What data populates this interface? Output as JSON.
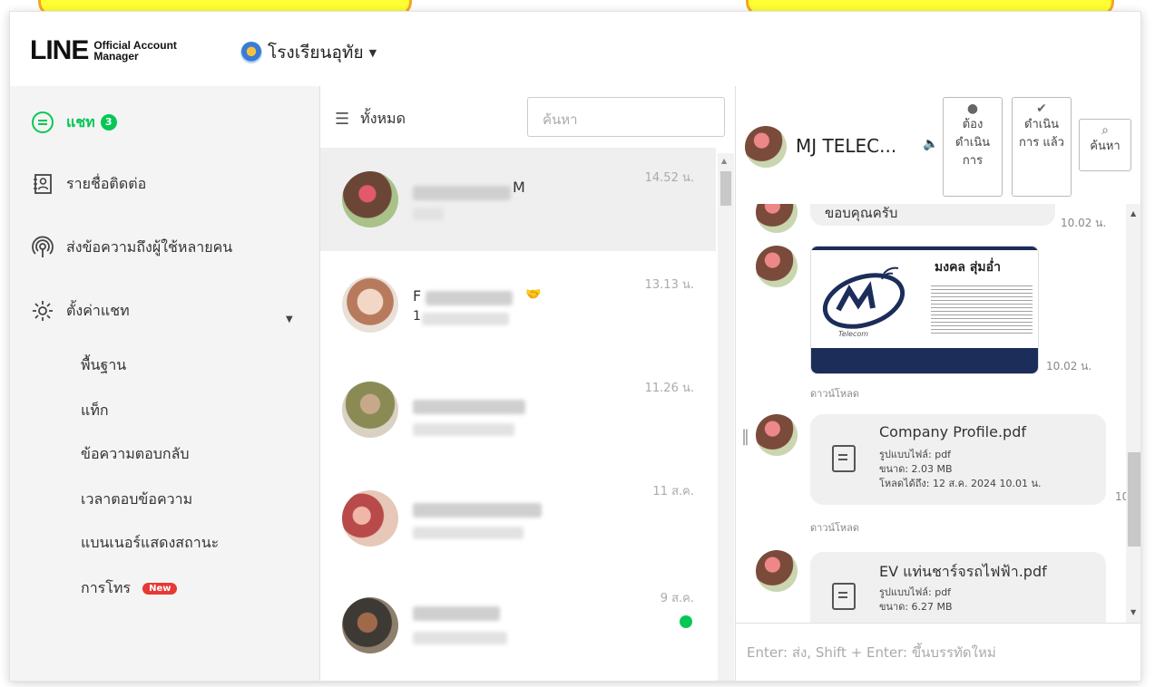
{
  "app": {
    "logo_main": "LINE",
    "logo_sub_1": "Official Account",
    "logo_sub_2": "Manager",
    "account_name": "โรงเรียนอุทัย"
  },
  "sidebar": {
    "items": [
      {
        "label": "แชท",
        "badge": "3",
        "icon": "chat-bubble-icon",
        "active": true
      },
      {
        "label": "รายชื่อติดต่อ",
        "icon": "contact-card-icon"
      },
      {
        "label": "ส่งข้อความถึงผู้ใช้หลายคน",
        "icon": "broadcast-icon"
      },
      {
        "label": "ตั้งค่าแชท",
        "icon": "gear-icon",
        "expanded": true
      }
    ],
    "sub_items": [
      {
        "label": "พื้นฐาน"
      },
      {
        "label": "แท็ก"
      },
      {
        "label": "ข้อความตอบกลับ"
      },
      {
        "label": "เวลาตอบข้อความ"
      },
      {
        "label": "แบนเนอร์แสดงสถานะ"
      },
      {
        "label": "การโทร",
        "badge": "New"
      }
    ]
  },
  "chat_list": {
    "filter_label": "ทั้งหมด",
    "search_placeholder": "ค้นหา",
    "rows": [
      {
        "name_visible": "M",
        "time": "14.52 น.",
        "selected": true
      },
      {
        "name_visible": "F",
        "time": "13.13 น.",
        "sub_visible": "1"
      },
      {
        "time": "11.26 น."
      },
      {
        "time": "11 ส.ค."
      },
      {
        "time": "9 ส.ค.",
        "unread": true
      }
    ]
  },
  "chat": {
    "contact_name": "MJ TELEC...",
    "buttons": {
      "todo_label": "ต้อง ดำเนิน การ",
      "done_label": "ดำเนิน การ แล้ว",
      "search_label": "ค้นหา"
    },
    "messages": [
      {
        "text": "ขอบคุณครับ",
        "time": "10.02 น."
      },
      {
        "type": "image",
        "time": "10.02 น.",
        "card_name": "มงคล สุ่มอ่ำ",
        "card_brand": "Telecom"
      },
      {
        "type": "file",
        "download_label": "ดาวน์โหลด",
        "file_name": "Company Profile.pdf",
        "meta_type": "รูปแบบไฟล์: pdf",
        "meta_size": "ขนาด: 2.03 MB",
        "meta_until": "โหลดได้ถึง: 12 ส.ค. 2024 10.01 น.",
        "time_partial": "10"
      },
      {
        "type": "file",
        "download_label": "ดาวน์โหลด",
        "file_name": "EV แท่นชาร์จรถไฟฟ้า.pdf",
        "meta_type": "รูปแบบไฟล์: pdf",
        "meta_size": "ขนาด: 6.27 MB"
      }
    ],
    "composer_placeholder": "Enter: ส่ง, Shift + Enter: ขึ้นบรรทัดใหม่"
  },
  "colors": {
    "accent_green": "#06c755",
    "new_badge_red": "#e53935",
    "callout_yellow": "#ffff33",
    "callout_border": "#f5a623"
  }
}
